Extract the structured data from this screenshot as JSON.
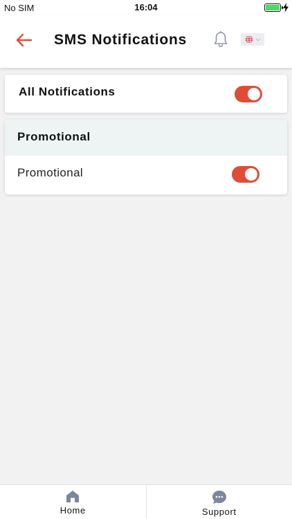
{
  "status_bar": {
    "carrier": "No SIM",
    "time": "16:04",
    "battery_level": 1.0,
    "battery_color": "#4cd964"
  },
  "header": {
    "title": "SMS Notifications",
    "back_icon": "arrow-left-icon",
    "bell_icon": "bell-icon",
    "language_icon": "globe-icon",
    "accent_color": "#e04c35"
  },
  "all_notifications": {
    "label": "All Notifications",
    "enabled": true
  },
  "promotional_section": {
    "header": "Promotional",
    "items": [
      {
        "label": "Promotional",
        "enabled": true
      }
    ]
  },
  "tabbar": {
    "tabs": [
      {
        "label": "Home",
        "icon": "home-icon"
      },
      {
        "label": "Support",
        "icon": "chat-bubble-icon"
      }
    ]
  }
}
